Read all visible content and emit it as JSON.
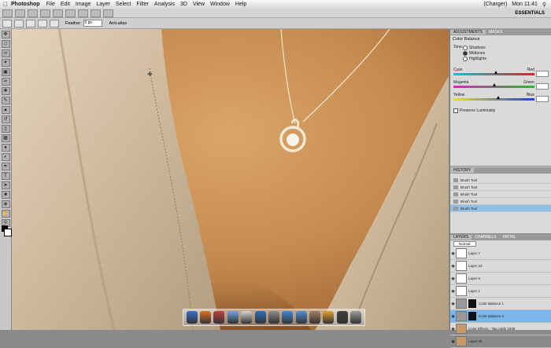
{
  "menubar": {
    "app": "Photoshop",
    "items": [
      "File",
      "Edit",
      "Image",
      "Layer",
      "Select",
      "Filter",
      "Analysis",
      "3D",
      "View",
      "Window",
      "Help"
    ],
    "user": "(Charger)",
    "clock": "Mon 11:41"
  },
  "appbar": {
    "workspace": "ESSENTIALS"
  },
  "options": {
    "feather_label": "Feather:",
    "feather_value": "0 px",
    "antialias": "Anti-alias"
  },
  "adjustments": {
    "tabs": [
      "ADJUSTMENTS",
      "MASKS"
    ],
    "title": "Color Balance",
    "tone_label": "Tone:",
    "tones": [
      "Shadows",
      "Midtones",
      "Highlights"
    ],
    "sliders": [
      {
        "left": "Cyan",
        "right": "Red",
        "gradient_left": "#00c8d8",
        "gradient_right": "#e02020",
        "value": 0.52
      },
      {
        "left": "Magenta",
        "right": "Green",
        "gradient_left": "#e020c8",
        "gradient_right": "#20c020",
        "value": 0.5
      },
      {
        "left": "Yellow",
        "right": "Blue",
        "gradient_left": "#e8e020",
        "gradient_right": "#2040e0",
        "value": 0.55
      }
    ],
    "preserve_label": "Preserve Luminosity"
  },
  "history": {
    "tab": "HISTORY",
    "items": [
      "Brush Tool",
      "Brush Tool",
      "Brush Tool",
      "Brush Tool",
      "Brush Tool"
    ]
  },
  "layers": {
    "tabs": [
      "LAYERS",
      "CHANNELS",
      "PATHS"
    ],
    "blend": "Normal",
    "items": [
      {
        "name": "Layer 7",
        "selected": false
      },
      {
        "name": "Layer 10",
        "selected": false
      },
      {
        "name": "Layer 6",
        "selected": false
      },
      {
        "name": "Layer 1",
        "selected": false
      },
      {
        "name": "Color Balance 1",
        "selected": false
      },
      {
        "name": "Color Balance 4",
        "selected": true
      },
      {
        "name": "Color Effects - Tap Adds 1838",
        "selected": false
      },
      {
        "name": "Layer 45",
        "selected": false
      }
    ]
  },
  "dock_colors": [
    "#3a6fd0",
    "#e07020",
    "#c04040",
    "#6aa0e0",
    "#d4d4d4",
    "#2a70c0",
    "#8a8a8a",
    "#3a8ad8",
    "#5090d8",
    "#a08060",
    "#e0a030",
    "#404040",
    "#9a9a9a"
  ]
}
